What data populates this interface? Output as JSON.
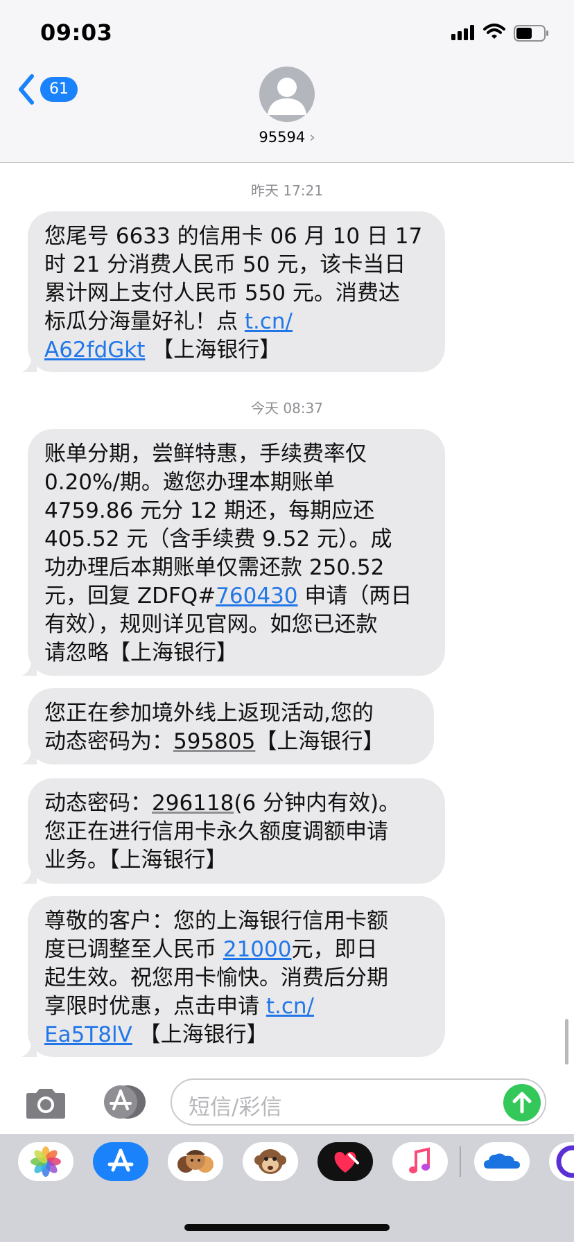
{
  "status_bar": {
    "time": "09:03"
  },
  "header": {
    "back_count": "61",
    "contact": "95594",
    "contact_chevron": "›"
  },
  "thread": {
    "timestamps": [
      "昨天 17:21",
      "今天 08:37"
    ],
    "messages": [
      {
        "line1": "您尾号 6633 的信用卡 06 月 10 日 17",
        "line2": "时 21 分消费人民币 50 元，该卡当日",
        "line3": "累计网上支付人民币 550 元。消费达",
        "line4_pre": "标瓜分海量好礼！点 ",
        "link_a": "t.cn/",
        "link_b": "A62fdGkt",
        "line5_post": "【上海银行】"
      },
      {
        "line1": "账单分期，尝鲜特惠，手续费率仅",
        "line2": "0.20%/期。邀您办理本期账单",
        "line3": "4759.86 元分 12 期还，每期应还",
        "line4": "405.52 元（含手续费 9.52 元）。成",
        "line5": "功办理后本期账单仅需还款 250.52",
        "line6_pre": "元，回复 ZDFQ#",
        "link": "760430",
        "line6_post": " 申请（两日",
        "line7": "有效），规则详见官网。如您已还款",
        "line8": "请忽略【上海银行】"
      },
      {
        "line1": "您正在参加境外线上返现活动,您的",
        "line2_pre": "动态密码为：",
        "code": "595805",
        "line2_post": "【上海银行】"
      },
      {
        "line1_pre": "动态密码：",
        "code": "296118",
        "line1_post": "(6 分钟内有效)。",
        "line2": "您正在进行信用卡永久额度调额申请",
        "line3": "业务。【上海银行】"
      },
      {
        "line1": "尊敬的客户：您的上海银行信用卡额",
        "line2_pre": "度已调整至人民币 ",
        "amount": "21000",
        "line2_post": "元，即日",
        "line3": "起生效。祝您用卡愉快。消费后分期",
        "line4_pre": "享限时优惠，点击申请 ",
        "link_a": "t.cn/",
        "link_b": "Ea5T8lV",
        "line5_post": "【上海银行】"
      }
    ]
  },
  "composer": {
    "placeholder": "短信/彩信"
  },
  "icons": {
    "back": "chevron-left-icon",
    "camera": "camera-icon",
    "app_store": "app-store-icon",
    "send": "arrow-up-icon"
  },
  "colors": {
    "link": "#2277e8",
    "badge": "#1a82fb",
    "send": "#34c759",
    "bubble": "#e9e9eb"
  }
}
